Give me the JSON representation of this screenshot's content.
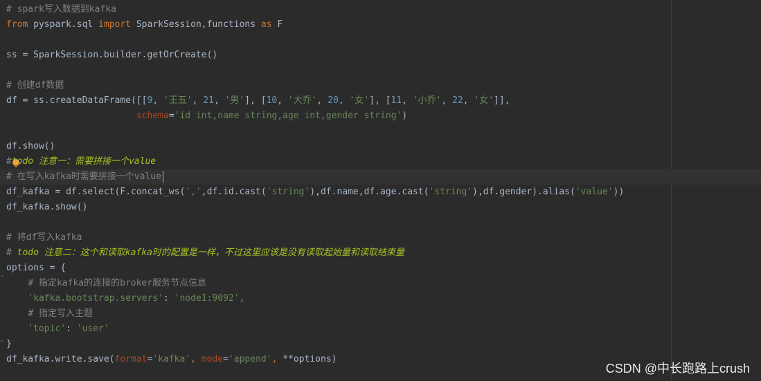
{
  "editor": {
    "lines": [
      {
        "segments": [
          {
            "t": "# spark写入数据到kafka",
            "c": "cm"
          }
        ]
      },
      {
        "segments": [
          {
            "t": "from",
            "c": "kw"
          },
          {
            "t": " pyspark.sql ",
            "c": ""
          },
          {
            "t": "import",
            "c": "kw"
          },
          {
            "t": " SparkSession,functions ",
            "c": ""
          },
          {
            "t": "as",
            "c": "kw"
          },
          {
            "t": " F",
            "c": ""
          }
        ]
      },
      {
        "segments": []
      },
      {
        "segments": [
          {
            "t": "ss = SparkSession.builder.getOrCreate()",
            "c": ""
          }
        ]
      },
      {
        "segments": []
      },
      {
        "segments": [
          {
            "t": "# 创建df数据",
            "c": "cm"
          }
        ]
      },
      {
        "segments": [
          {
            "t": "df = ss.createDataFrame([[",
            "c": ""
          },
          {
            "t": "9",
            "c": "num"
          },
          {
            "t": ", ",
            "c": ""
          },
          {
            "t": "'王五'",
            "c": "str"
          },
          {
            "t": ", ",
            "c": ""
          },
          {
            "t": "21",
            "c": "num"
          },
          {
            "t": ", ",
            "c": ""
          },
          {
            "t": "'男'",
            "c": "str"
          },
          {
            "t": "], [",
            "c": ""
          },
          {
            "t": "10",
            "c": "num"
          },
          {
            "t": ", ",
            "c": ""
          },
          {
            "t": "'大乔'",
            "c": "str"
          },
          {
            "t": ", ",
            "c": ""
          },
          {
            "t": "20",
            "c": "num"
          },
          {
            "t": ", ",
            "c": ""
          },
          {
            "t": "'女'",
            "c": "str"
          },
          {
            "t": "], [",
            "c": ""
          },
          {
            "t": "11",
            "c": "num"
          },
          {
            "t": ", ",
            "c": ""
          },
          {
            "t": "'小乔'",
            "c": "str"
          },
          {
            "t": ", ",
            "c": ""
          },
          {
            "t": "22",
            "c": "num"
          },
          {
            "t": ", ",
            "c": ""
          },
          {
            "t": "'女'",
            "c": "str"
          },
          {
            "t": "]],",
            "c": ""
          }
        ]
      },
      {
        "segments": [
          {
            "t": "                        ",
            "c": ""
          },
          {
            "t": "schema",
            "c": "param"
          },
          {
            "t": "=",
            "c": ""
          },
          {
            "t": "'id int,name string,age int,gender string'",
            "c": "str"
          },
          {
            "t": ")",
            "c": ""
          }
        ]
      },
      {
        "segments": []
      },
      {
        "segments": [
          {
            "t": "df.show()",
            "c": ""
          }
        ]
      },
      {
        "segments": [
          {
            "t": "#",
            "c": "cm"
          },
          {
            "t": "todo 注意一：需要拼接一个value",
            "c": "todo"
          }
        ]
      },
      {
        "segments": [
          {
            "t": "# 在写入kafka时需要拼接一个value",
            "c": "cm"
          }
        ]
      },
      {
        "segments": [
          {
            "t": "df_kafka = df.select(F.concat_ws(",
            "c": ""
          },
          {
            "t": "','",
            "c": "str"
          },
          {
            "t": ",df.id.cast(",
            "c": ""
          },
          {
            "t": "'string'",
            "c": "str"
          },
          {
            "t": "),df.name,df.age.cast(",
            "c": ""
          },
          {
            "t": "'string'",
            "c": "str"
          },
          {
            "t": "),df.gender).alias(",
            "c": ""
          },
          {
            "t": "'value'",
            "c": "str"
          },
          {
            "t": "))",
            "c": ""
          }
        ]
      },
      {
        "segments": [
          {
            "t": "df_kafka.show()",
            "c": ""
          }
        ]
      },
      {
        "segments": []
      },
      {
        "segments": [
          {
            "t": "# 将df写入kafka",
            "c": "cm"
          }
        ]
      },
      {
        "segments": [
          {
            "t": "# ",
            "c": "cm"
          },
          {
            "t": "todo 注意二：这个和读取kafka时的配置是一样，不过这里应该是没有读取起始量和读取结束量",
            "c": "todo"
          }
        ]
      },
      {
        "segments": [
          {
            "t": "options = {",
            "c": ""
          }
        ]
      },
      {
        "segments": [
          {
            "t": "    ",
            "c": ""
          },
          {
            "t": "# 指定kafka的连接的broker服务节点信息",
            "c": "cm"
          }
        ]
      },
      {
        "segments": [
          {
            "t": "    ",
            "c": ""
          },
          {
            "t": "'kafka.bootstrap.servers'",
            "c": "str"
          },
          {
            "t": ": ",
            "c": ""
          },
          {
            "t": "'node1:9092'",
            "c": "str"
          },
          {
            "t": ",",
            "c": "kw"
          }
        ]
      },
      {
        "segments": [
          {
            "t": "    ",
            "c": ""
          },
          {
            "t": "# 指定写入主题",
            "c": "cm"
          }
        ]
      },
      {
        "segments": [
          {
            "t": "    ",
            "c": ""
          },
          {
            "t": "'topic'",
            "c": "str"
          },
          {
            "t": ": ",
            "c": ""
          },
          {
            "t": "'user'",
            "c": "str"
          }
        ]
      },
      {
        "segments": [
          {
            "t": "}",
            "c": ""
          }
        ]
      },
      {
        "segments": [
          {
            "t": "df_kafka.write.save(",
            "c": ""
          },
          {
            "t": "format",
            "c": "param"
          },
          {
            "t": "=",
            "c": ""
          },
          {
            "t": "'kafka'",
            "c": "str"
          },
          {
            "t": ", ",
            "c": "kw"
          },
          {
            "t": "mode",
            "c": "param"
          },
          {
            "t": "=",
            "c": ""
          },
          {
            "t": "'append'",
            "c": "str"
          },
          {
            "t": ", ",
            "c": "kw"
          },
          {
            "t": "**options)",
            "c": ""
          }
        ]
      }
    ]
  },
  "watermark": "CSDN @中长跑路上crush",
  "colors": {
    "background": "#2b2b2b",
    "keyword": "#cc7832",
    "string": "#6a8759",
    "number": "#6897bb",
    "comment": "#808080",
    "todo": "#a8c023",
    "param": "#aa4926"
  }
}
